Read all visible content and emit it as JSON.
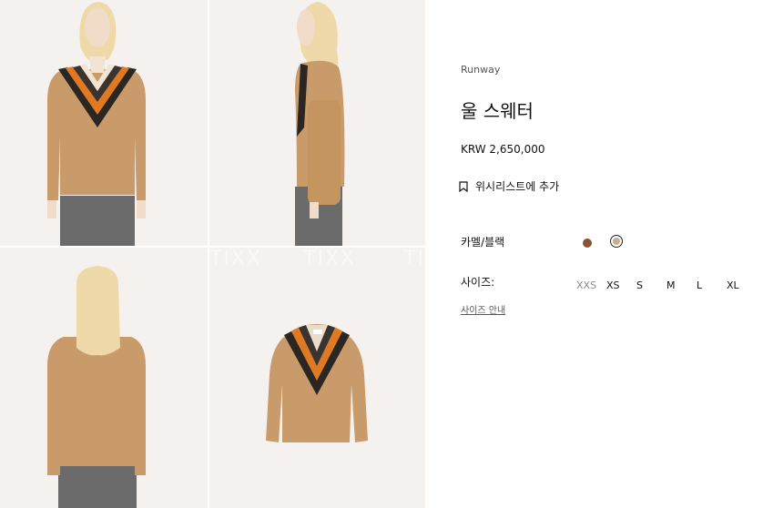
{
  "gallery": {
    "watermark": "TIXX",
    "images": [
      {
        "name": "model-front-view"
      },
      {
        "name": "model-side-view"
      },
      {
        "name": "model-back-view"
      },
      {
        "name": "product-flat-view"
      }
    ]
  },
  "product": {
    "collection": "Runway",
    "title": "울 스웨터",
    "price": "KRW 2,650,000",
    "wishlist_label": "위시리스트에 추가",
    "color_label": "카멜/블랙",
    "colors": [
      {
        "name": "brown",
        "hex": "#8a5432"
      },
      {
        "name": "camel",
        "hex": "#c9ad8c",
        "selected": true
      }
    ],
    "size_label": "사이즈:",
    "sizes": [
      "XXS",
      "XS",
      "S",
      "M",
      "L",
      "XL"
    ],
    "size_guide": "사이즈 안내"
  }
}
